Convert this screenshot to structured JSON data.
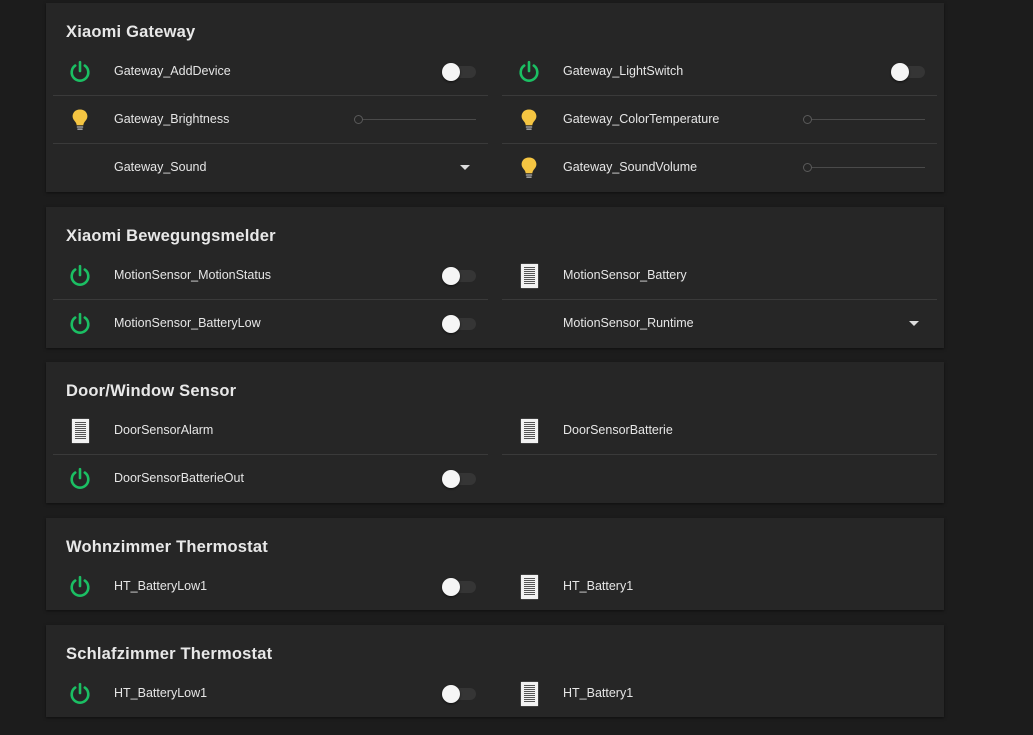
{
  "colors": {
    "accent_green": "#1bbf63",
    "bulb_yellow": "#f5c542"
  },
  "cards": [
    {
      "title": "Xiaomi Gateway",
      "items": [
        {
          "label": "Gateway_AddDevice",
          "icon": "power-icon",
          "control": "toggle",
          "state": "off"
        },
        {
          "label": "Gateway_LightSwitch",
          "icon": "power-icon",
          "control": "toggle",
          "state": "off"
        },
        {
          "label": "Gateway_Brightness",
          "icon": "lightbulb-icon",
          "control": "slider"
        },
        {
          "label": "Gateway_ColorTemperature",
          "icon": "lightbulb-icon",
          "control": "slider"
        },
        {
          "label": "Gateway_Sound",
          "icon": "none",
          "control": "dropdown"
        },
        {
          "label": "Gateway_SoundVolume",
          "icon": "lightbulb-icon",
          "control": "slider"
        }
      ]
    },
    {
      "title": "Xiaomi Bewegungsmelder",
      "items": [
        {
          "label": "MotionSensor_MotionStatus",
          "icon": "power-icon",
          "control": "toggle",
          "state": "off"
        },
        {
          "label": "MotionSensor_Battery",
          "icon": "document-icon",
          "control": "none"
        },
        {
          "label": "MotionSensor_BatteryLow",
          "icon": "power-icon",
          "control": "toggle",
          "state": "off"
        },
        {
          "label": "MotionSensor_Runtime",
          "icon": "none",
          "control": "dropdown"
        }
      ]
    },
    {
      "title": "Door/Window Sensor",
      "items": [
        {
          "label": "DoorSensorAlarm",
          "icon": "document-icon",
          "control": "none"
        },
        {
          "label": "DoorSensorBatterie",
          "icon": "document-icon",
          "control": "none"
        },
        {
          "label": "DoorSensorBatterieOut",
          "icon": "power-icon",
          "control": "toggle",
          "state": "off"
        }
      ]
    },
    {
      "title": "Wohnzimmer Thermostat",
      "items": [
        {
          "label": "HT_BatteryLow1",
          "icon": "power-icon",
          "control": "toggle",
          "state": "off"
        },
        {
          "label": "HT_Battery1",
          "icon": "document-icon",
          "control": "none"
        }
      ]
    },
    {
      "title": "Schlafzimmer Thermostat",
      "items": [
        {
          "label": "HT_BatteryLow1",
          "icon": "power-icon",
          "control": "toggle",
          "state": "off"
        },
        {
          "label": "HT_Battery1",
          "icon": "document-icon",
          "control": "none"
        }
      ]
    }
  ]
}
